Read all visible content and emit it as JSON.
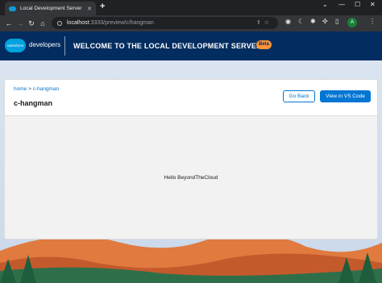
{
  "browser": {
    "tab_title": "Local Development Server",
    "tab_close": "✕",
    "new_tab": "+",
    "url_host": "localhost",
    "url_path": ":3333/preview/c/hangman",
    "avatar_initial": "A",
    "window_controls": [
      "⌄",
      "—",
      "☐",
      "✕"
    ]
  },
  "header": {
    "logo_text": "salesforce",
    "brand": "developers",
    "title": "WELCOME TO THE LOCAL DEVELOPMENT SERVER",
    "badge": "Beta"
  },
  "card": {
    "breadcrumb_home": "home",
    "breadcrumb_separator": ">",
    "breadcrumb_current": "c-hangman",
    "title": "c-hangman",
    "go_back_label": "Go Back",
    "vscode_label": "View in VS Code",
    "output_text": "Hello BeyondTheCloud"
  },
  "colors": {
    "brand_blue": "#0176d3",
    "header_navy": "#032d60",
    "beta_orange": "#fe9339"
  }
}
